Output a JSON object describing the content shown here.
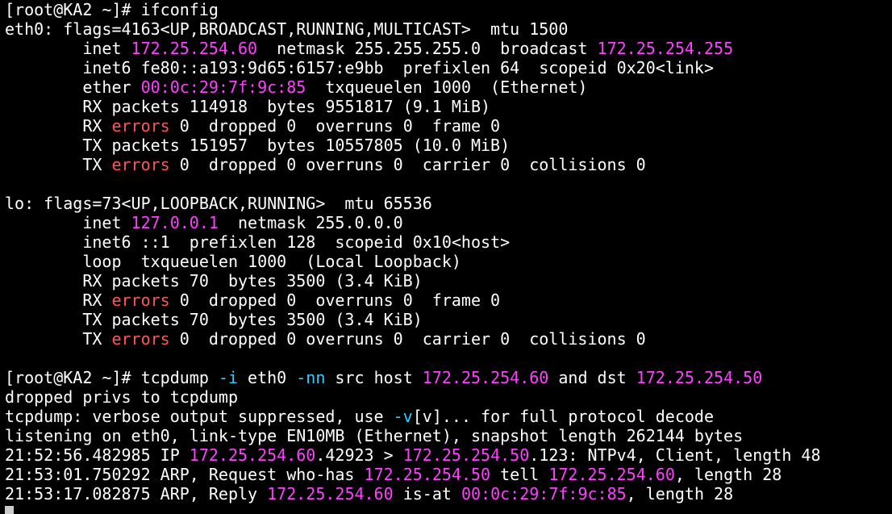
{
  "colors": {
    "background": "#000000",
    "text": "#ffffff",
    "highlight": "#ff40ff",
    "error": "#ff5555",
    "option": "#33ccff",
    "cursor": "#cccccc"
  },
  "terminal": {
    "lines": [
      [
        {
          "t": "[root@KA2 ~]# ifconfig",
          "c": "w"
        }
      ],
      [
        {
          "t": "eth0: flags=4163<UP,BROADCAST,RUNNING,MULTICAST>  mtu 1500",
          "c": "w"
        }
      ],
      [
        {
          "t": "        inet ",
          "c": "w"
        },
        {
          "t": "172.25.254.60",
          "c": "m"
        },
        {
          "t": "  netmask 255.255.255.0  broadcast ",
          "c": "w"
        },
        {
          "t": "172.25.254.255",
          "c": "m"
        }
      ],
      [
        {
          "t": "        inet6 fe80::a193:9d65:6157:e9bb  prefixlen 64  scopeid 0x20<link>",
          "c": "w"
        }
      ],
      [
        {
          "t": "        ether ",
          "c": "w"
        },
        {
          "t": "00:0c:29:7f:9c:85",
          "c": "m"
        },
        {
          "t": "  txqueuelen 1000  (Ethernet)",
          "c": "w"
        }
      ],
      [
        {
          "t": "        RX packets 114918  bytes 9551817 (9.1 MiB)",
          "c": "w"
        }
      ],
      [
        {
          "t": "        RX ",
          "c": "w"
        },
        {
          "t": "errors",
          "c": "r"
        },
        {
          "t": " 0  dropped 0  overruns 0  frame 0",
          "c": "w"
        }
      ],
      [
        {
          "t": "        TX packets 151957  bytes 10557805 (10.0 MiB)",
          "c": "w"
        }
      ],
      [
        {
          "t": "        TX ",
          "c": "w"
        },
        {
          "t": "errors",
          "c": "r"
        },
        {
          "t": " 0  dropped 0 overruns 0  carrier 0  collisions 0",
          "c": "w"
        }
      ],
      [
        {
          "t": "",
          "c": "w"
        }
      ],
      [
        {
          "t": "lo: flags=73<UP,LOOPBACK,RUNNING>  mtu 65536",
          "c": "w"
        }
      ],
      [
        {
          "t": "        inet ",
          "c": "w"
        },
        {
          "t": "127.0.0.1",
          "c": "m"
        },
        {
          "t": "  netmask 255.0.0.0",
          "c": "w"
        }
      ],
      [
        {
          "t": "        inet6 ::1  prefixlen 128  scopeid 0x10<host>",
          "c": "w"
        }
      ],
      [
        {
          "t": "        loop  txqueuelen 1000  (Local Loopback)",
          "c": "w"
        }
      ],
      [
        {
          "t": "        RX packets 70  bytes 3500 (3.4 KiB)",
          "c": "w"
        }
      ],
      [
        {
          "t": "        RX ",
          "c": "w"
        },
        {
          "t": "errors",
          "c": "r"
        },
        {
          "t": " 0  dropped 0  overruns 0  frame 0",
          "c": "w"
        }
      ],
      [
        {
          "t": "        TX packets 70  bytes 3500 (3.4 KiB)",
          "c": "w"
        }
      ],
      [
        {
          "t": "        TX ",
          "c": "w"
        },
        {
          "t": "errors",
          "c": "r"
        },
        {
          "t": " 0  dropped 0 overruns 0  carrier 0  collisions 0",
          "c": "w"
        }
      ],
      [
        {
          "t": "",
          "c": "w"
        }
      ],
      [
        {
          "t": "[root@KA2 ~]# tcpdump ",
          "c": "w"
        },
        {
          "t": "-i",
          "c": "c"
        },
        {
          "t": " eth0 ",
          "c": "w"
        },
        {
          "t": "-nn",
          "c": "c"
        },
        {
          "t": " src host ",
          "c": "w"
        },
        {
          "t": "172.25.254.60",
          "c": "m"
        },
        {
          "t": " and dst ",
          "c": "w"
        },
        {
          "t": "172.25.254.50",
          "c": "m"
        }
      ],
      [
        {
          "t": "dropped privs to tcpdump",
          "c": "w"
        }
      ],
      [
        {
          "t": "tcpdump: verbose output suppressed, use ",
          "c": "w"
        },
        {
          "t": "-v",
          "c": "c"
        },
        {
          "t": "[v]... for full protocol decode",
          "c": "w"
        }
      ],
      [
        {
          "t": "listening on eth0, link-type EN10MB (Ethernet), snapshot length 262144 bytes",
          "c": "w"
        }
      ],
      [
        {
          "t": "21:52:56.482985 IP ",
          "c": "w"
        },
        {
          "t": "172.25.254.60",
          "c": "m"
        },
        {
          "t": ".42923 > ",
          "c": "w"
        },
        {
          "t": "172.25.254.50",
          "c": "m"
        },
        {
          "t": ".123: NTPv4, Client, length 48",
          "c": "w"
        }
      ],
      [
        {
          "t": "21:53:01.750292 ARP, Request who-has ",
          "c": "w"
        },
        {
          "t": "172.25.254.50",
          "c": "m"
        },
        {
          "t": " tell ",
          "c": "w"
        },
        {
          "t": "172.25.254.60",
          "c": "m"
        },
        {
          "t": ", length 28",
          "c": "w"
        }
      ],
      [
        {
          "t": "21:53:17.082875 ARP, Reply ",
          "c": "w"
        },
        {
          "t": "172.25.254.60",
          "c": "m"
        },
        {
          "t": " is-at ",
          "c": "w"
        },
        {
          "t": "00:0c:29:7f:9c:85",
          "c": "m"
        },
        {
          "t": ", length 28",
          "c": "w"
        }
      ]
    ]
  }
}
